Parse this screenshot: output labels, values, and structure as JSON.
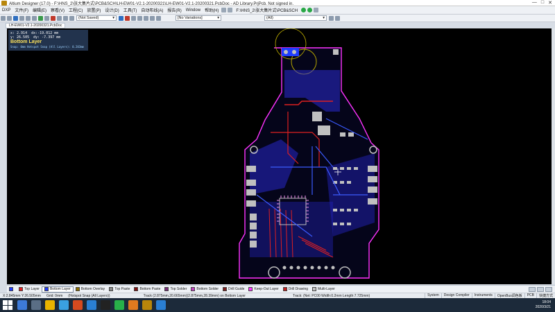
{
  "window": {
    "title": "Altium Designer (17.0) - F:\\HNS_2\\张大集片式\\PCB&SCH\\LH-EW01-V2.1-20200321\\LH-EW01-V2.1-20200321.PcbDoc - AD Library.PrjPcb. Not signed in."
  },
  "menu": {
    "items": [
      "DXP",
      "文件(F)",
      "编辑(E)",
      "察看(V)",
      "工程(C)",
      "放置(P)",
      "设计(D)",
      "工具(T)",
      "自动布线(A)",
      "报告(R)",
      "Window",
      "帮助(H)"
    ],
    "path": "F:\\HNS_2\\张大集片式\\PCB&SCH"
  },
  "toolbar": {
    "saved_state": "(Not Saved)",
    "variations": "[No Variations]",
    "filter": "(All)"
  },
  "document_tab": {
    "label": "LH-EW01-V2.1-20200321.PcbDoc"
  },
  "hud": {
    "x": "x:  2.914",
    "dx": "dx:-19.012 mm",
    "y": "y: 26.505",
    "dy": "dy: -7.397  mm",
    "layer": "Bottom Layer",
    "snap": "Snap: 0mm Hotspot Snap (All Layers): 0.203mm"
  },
  "layers": [
    {
      "name": "Top Layer",
      "color": "#e02020"
    },
    {
      "name": "Bottom Layer",
      "color": "#1f3cff",
      "active": true
    },
    {
      "name": "Bottom Overlay",
      "color": "#8a6d00"
    },
    {
      "name": "Top Paste",
      "color": "#8a8a8a"
    },
    {
      "name": "Bottom Paste",
      "color": "#801010"
    },
    {
      "name": "Top Solder",
      "color": "#7a2e7a"
    },
    {
      "name": "Bottom Solder",
      "color": "#c040c0"
    },
    {
      "name": "Drill Guide",
      "color": "#7a1f1f"
    },
    {
      "name": "Keep-Out Layer",
      "color": "#ff33ff"
    },
    {
      "name": "Drill Drawing",
      "color": "#c02020"
    },
    {
      "name": "Multi-Layer",
      "color": "#c0c0c0"
    }
  ],
  "status": {
    "coords": "X:2.845mm Y:26.505mm",
    "grid": "Grid: 0mm",
    "snap": "(Hotspot Snap (All Layers))",
    "track": "Track (2.875mm,20.665mm)(2.875mm,28.39mm) on Bottom Layer",
    "net": "Track: (Net: PC00 Width:0.2mm Length:7.725mm)",
    "panels": [
      "System",
      "Design Compiler",
      "Instruments",
      "OpenBus调色板",
      "PCB",
      "快捷方式"
    ]
  },
  "taskbar": {
    "time": "18:04",
    "date": "2020/3/21"
  }
}
